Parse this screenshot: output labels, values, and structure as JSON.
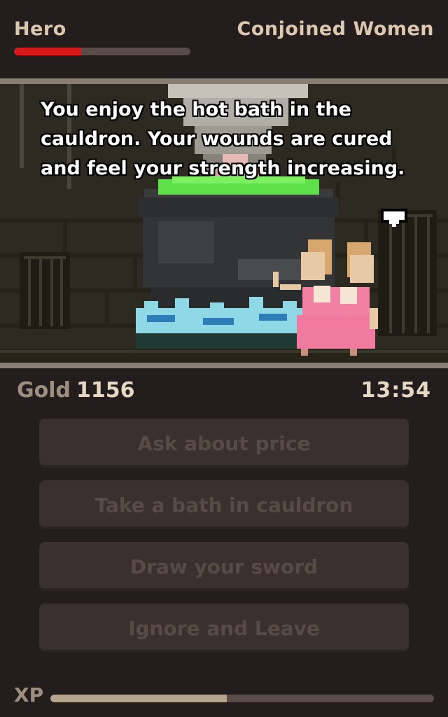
{
  "header": {
    "hero_name": "Hero",
    "enemy_name": "Conjoined Women",
    "hero_health_fraction": 0.38
  },
  "scene": {
    "message": "You enjoy the hot bath in the cauldron. Your wounds are cured and feel your strength increasing.",
    "icons": [
      "cauldron-icon",
      "hero-in-bath-icon",
      "conjoined-women-icon",
      "speech-bubble-icon"
    ]
  },
  "status": {
    "gold_label": "Gold",
    "gold_value": "1156",
    "timer": "13:54"
  },
  "choices": [
    {
      "label": "Ask about price"
    },
    {
      "label": "Take a bath in cauldron"
    },
    {
      "label": "Draw your sword"
    },
    {
      "label": "Ignore and Leave"
    }
  ],
  "footer": {
    "xp_label": "XP",
    "xp_fraction": 0.46
  },
  "colors": {
    "background": "#231d1e",
    "health": "#d91a1a",
    "xp": "#b5a48e",
    "potion_green": "#5ee04a",
    "dress_pink": "#f27fa4"
  }
}
